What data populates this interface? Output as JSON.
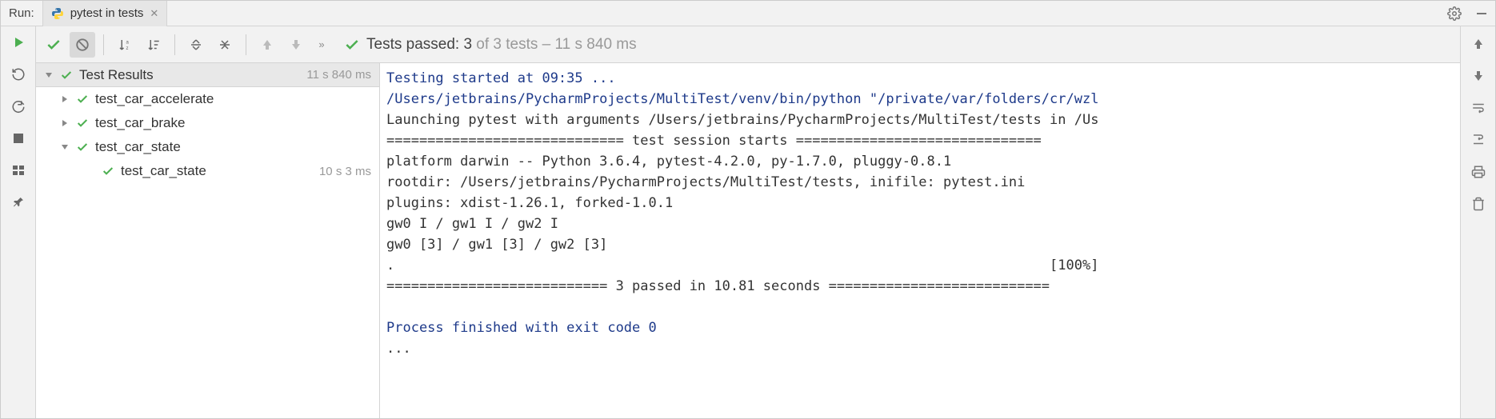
{
  "header": {
    "run_label": "Run:",
    "tab_label": "pytest in tests"
  },
  "status": {
    "prefix": "Tests passed: ",
    "count": "3",
    "suffix": " of 3 tests – 11 s 840 ms"
  },
  "tree": {
    "root": {
      "label": "Test Results",
      "time": "11 s 840 ms"
    },
    "nodes": [
      {
        "label": "test_car_accelerate",
        "time": ""
      },
      {
        "label": "test_car_brake",
        "time": ""
      },
      {
        "label": "test_car_state",
        "time": "",
        "children": [
          {
            "label": "test_car_state",
            "time": "10 s 3 ms"
          }
        ]
      }
    ]
  },
  "console": {
    "l1": "Testing started at 09:35 ...",
    "l2": "/Users/jetbrains/PycharmProjects/MultiTest/venv/bin/python \"/private/var/folders/cr/wzl",
    "l3": "Launching pytest with arguments /Users/jetbrains/PycharmProjects/MultiTest/tests in /Us",
    "l4": "============================= test session starts ==============================",
    "l5": "platform darwin -- Python 3.6.4, pytest-4.2.0, py-1.7.0, pluggy-0.8.1",
    "l6": "rootdir: /Users/jetbrains/PycharmProjects/MultiTest/tests, inifile: pytest.ini",
    "l7": "plugins: xdist-1.26.1, forked-1.0.1",
    "l8": "gw0 I / gw1 I / gw2 I",
    "l9": "gw0 [3] / gw1 [3] / gw2 [3]",
    "l10a": ".",
    "l10b": "[100%]",
    "l11": "=========================== 3 passed in 10.81 seconds ===========================",
    "l12": "",
    "l13": "Process finished with exit code 0",
    "l14": "..."
  }
}
